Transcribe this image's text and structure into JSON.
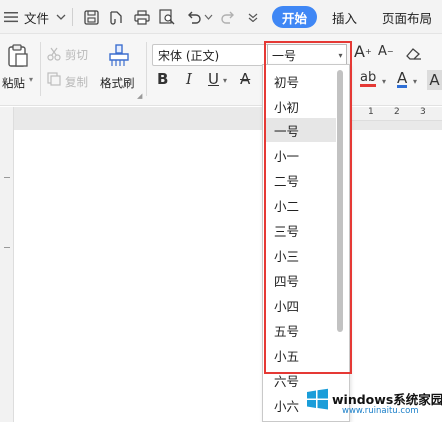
{
  "menubar": {
    "file_label": "文件",
    "tabs": [
      {
        "label": "开始",
        "active": true
      },
      {
        "label": "插入",
        "active": false
      },
      {
        "label": "页面布局",
        "active": false
      }
    ]
  },
  "ribbon": {
    "paste_label": "粘贴",
    "cut_label": "剪切",
    "copy_label": "复制",
    "format_painter_label": "格式刷",
    "font_name": "宋体 (正文)",
    "font_size": "一号",
    "bold_label": "B",
    "italic_label": "I",
    "underline_label": "U",
    "strikethrough_label": "A",
    "highlight_label": "ab",
    "font_color_label": "A",
    "grow_label": "A",
    "shrink_label": "A",
    "clear_label": "A"
  },
  "ruler": {
    "numbers": [
      "1",
      "2",
      "3"
    ]
  },
  "font_size_dropdown": {
    "items": [
      "初号",
      "小初",
      "一号",
      "小一",
      "二号",
      "小二",
      "三号",
      "小三",
      "四号",
      "小四",
      "五号",
      "小五",
      "六号",
      "小六"
    ],
    "selected": "一号"
  },
  "watermark": {
    "text": "windows系统家园",
    "url": "www.ruinaitu.com"
  },
  "colors": {
    "accent": "#3f87f5",
    "highlight_box": "#e53935",
    "underline_red": "#e53935",
    "font_color_blue": "#2f6fd6"
  }
}
